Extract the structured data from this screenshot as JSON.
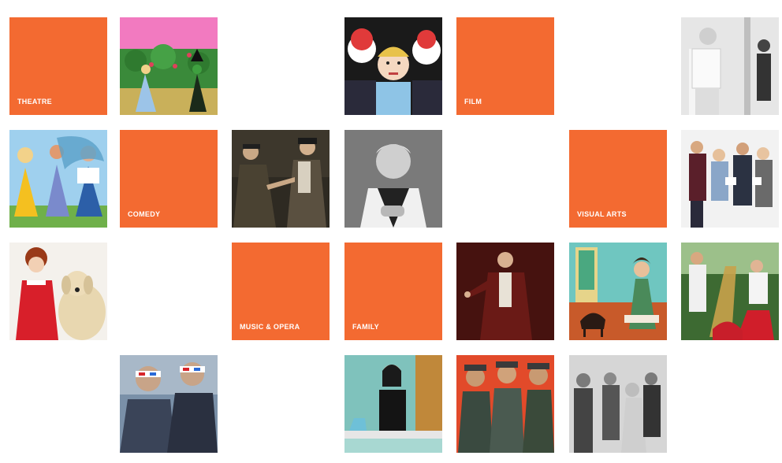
{
  "categories": {
    "theatre": "THEATRE",
    "film": "FILM",
    "comedy": "COMEDY",
    "visual_arts": "VISUAL ARTS",
    "music_opera": "MUSIC & OPERA",
    "family": "FAMILY"
  },
  "colors": {
    "accent": "#f36a31",
    "background": "#ffffff"
  }
}
